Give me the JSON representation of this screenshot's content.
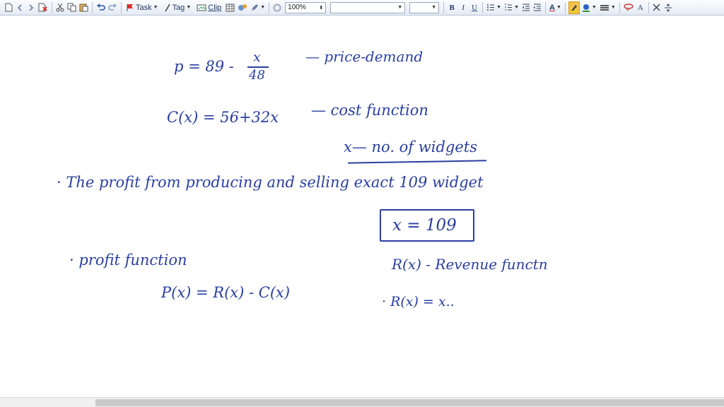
{
  "toolbar": {
    "task_label": "Task",
    "tag_label": "Tag",
    "clip_label": "Clip",
    "zoom_value": "100%",
    "bold": "B",
    "italic": "I",
    "underline": "U",
    "text_color": "A",
    "font_size_glyph": "A",
    "icons": [
      "page-icon",
      "back-icon",
      "forward-icon",
      "delete-icon",
      "cut-icon",
      "copy-icon",
      "paste-icon",
      "undo-icon",
      "redo-icon",
      "task-icon",
      "tag-icon",
      "clip-icon",
      "table-icon",
      "attach-icon",
      "pen-icon",
      "globe-icon",
      "bullets-icon",
      "numbering-icon",
      "outdent-icon",
      "indent-icon",
      "highlighter-icon",
      "pen-color-icon",
      "line-style-icon",
      "lasso-icon",
      "close-icon",
      "spacing-icon"
    ]
  },
  "notes": {
    "line1_lhs": "p = 89 -",
    "line1_num": "x",
    "line1_den": "48",
    "line1_label": "— price-demand",
    "line2": "C(x) = 56+32x",
    "line2_label": "— cost function",
    "line3": "x— no. of widgets",
    "line4": "· The profit from producing and selling exact 109 widget",
    "boxed": "x = 109",
    "line5": "· profit function",
    "line6": "P(x) = R(x) - C(x)",
    "line7": "R(x) - Revenue functn",
    "line8": "· R(x) = x.."
  },
  "colors": {
    "ink": "#2a3fa0",
    "toolbar_bg": "#e4ebf5",
    "highlighter": "#f2c24b"
  }
}
